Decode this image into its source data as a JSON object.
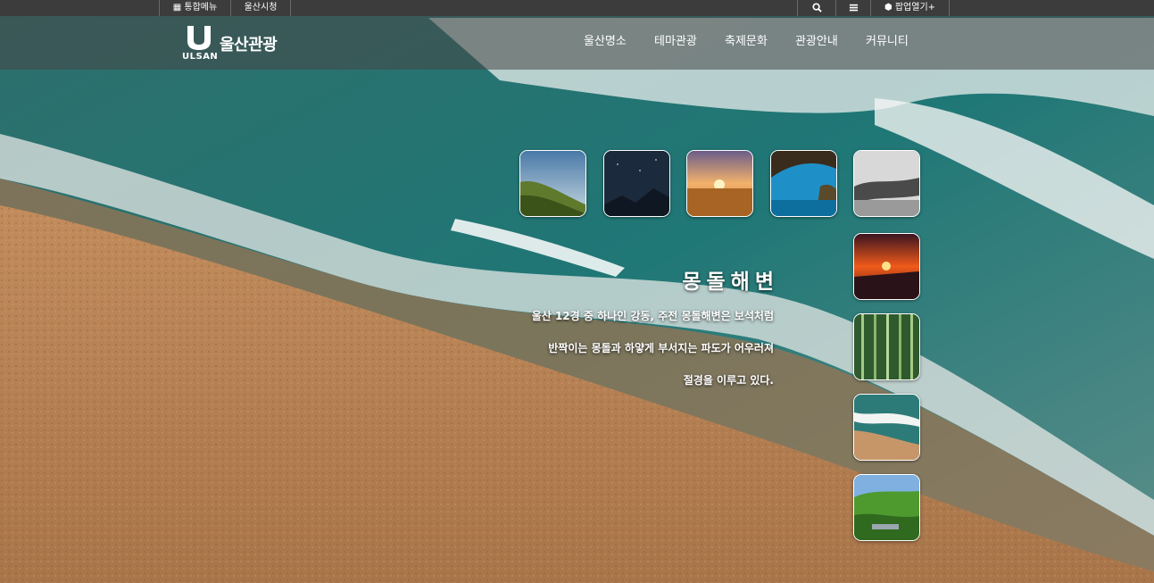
{
  "utility_bar": {
    "menu_label": "통합메뉴",
    "city_label": "울산시청",
    "popup_label": "팝업열기+",
    "icons": [
      "grid-icon",
      "search-icon",
      "menu-icon",
      "popup-icon"
    ]
  },
  "header": {
    "logo_mark": "U",
    "logo_sub": "ULSAN",
    "logo_title": "울산관광",
    "nav": [
      "울산명소",
      "테마관광",
      "축제문화",
      "관광안내",
      "커뮤니티"
    ]
  },
  "hero": {
    "title": "몽돌해변",
    "description_lines": [
      "울산 12경 중 하나인 강동, 주전 몽돌해변은 보석처럼",
      "반짝이는 몽돌과 하얗게 부서지는 파도가 어우러져",
      "절경을 이루고 있다."
    ]
  },
  "thumbnails": [
    "mountain-coast",
    "starry-night",
    "sunset-field",
    "sea-cliff",
    "misty-mountains",
    "sunset-sea",
    "bamboo-forest",
    "beach-waves",
    "green-valley"
  ],
  "colors": {
    "utility_bar": "#3c3c3c",
    "text": "#ffffff"
  }
}
